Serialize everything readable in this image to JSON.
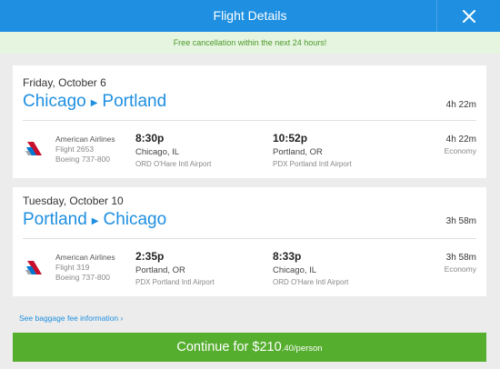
{
  "header": {
    "title": "Flight Details",
    "close_icon": "close-icon"
  },
  "notice": "Free cancellation within the next 24 hours!",
  "trips": [
    {
      "date": "Friday, October 6",
      "origin": "Chicago",
      "destination": "Portland",
      "total_duration": "4h 22m",
      "leg": {
        "airline": "American Airlines",
        "flight": "Flight 2653",
        "aircraft": "Boeing 737-800",
        "depart_time": "8:30p",
        "depart_city": "Chicago, IL",
        "depart_airport": "ORD O'Hare Intl Airport",
        "arrive_time": "10:52p",
        "arrive_city": "Portland, OR",
        "arrive_airport": "PDX Portland Intl Airport",
        "duration": "4h 22m",
        "cabin": "Economy"
      }
    },
    {
      "date": "Tuesday, October 10",
      "origin": "Portland",
      "destination": "Chicago",
      "total_duration": "3h 58m",
      "leg": {
        "airline": "American Airlines",
        "flight": "Flight 319",
        "aircraft": "Boeing 737-800",
        "depart_time": "2:35p",
        "depart_city": "Portland, OR",
        "depart_airport": "PDX Portland Intl Airport",
        "arrive_time": "8:33p",
        "arrive_city": "Chicago, IL",
        "arrive_airport": "ORD O'Hare Intl Airport",
        "duration": "3h 58m",
        "cabin": "Economy"
      }
    }
  ],
  "baggage_link": "See baggage fee information",
  "continue_button": {
    "prefix": "Continue for ",
    "price_main": "$210",
    "price_suffix": ".40/person"
  },
  "colors": {
    "header": "#1e8fe1",
    "accent": "#1e8fe1",
    "button": "#56ae2f",
    "notice_text": "#4c9a2a",
    "notice_bg": "#e6f5e0"
  }
}
